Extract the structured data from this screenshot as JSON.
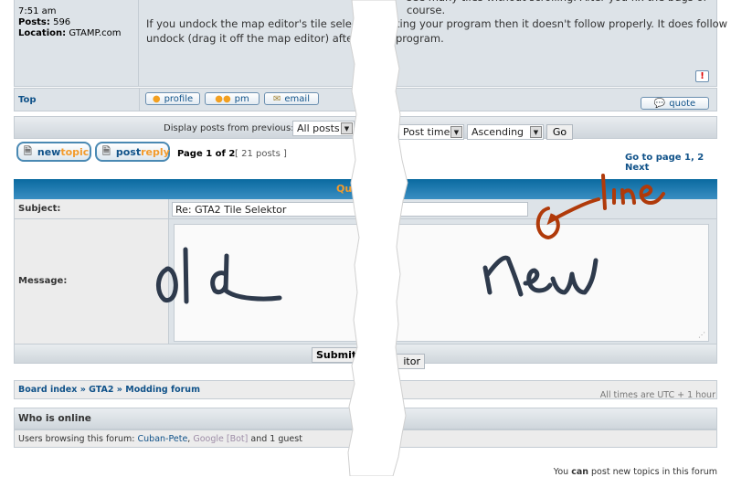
{
  "post": {
    "profile": {
      "joined_time": "7:51 am",
      "posts_label": "Posts:",
      "posts": "596",
      "location_label": "Location:",
      "location": "GTAMP.com"
    },
    "message_line0": "see many tiles without scrolling. After you fix the bugs of course.",
    "message_left_line1": "If you undock the map editor's tile selector be",
    "message_left_line2": "undock (drag it off the map editor) after run",
    "message_right_line1": "ting your program then it doesn't follow properly. It does follow if I",
    "message_right_line2": "program.",
    "top_link": "Top",
    "buttons": {
      "profile": "profile",
      "pm": "pm",
      "email": "email",
      "quote": "quote"
    }
  },
  "display_bar": {
    "label": "Display posts from previous:",
    "range": "All posts",
    "sort_by": "Post time",
    "order": "Ascending",
    "go": "Go"
  },
  "buttons": {
    "new_a": "new",
    "new_b": "topic",
    "post_a": "post",
    "post_b": "reply"
  },
  "pagination": {
    "page": "Page 1 of 2",
    "count": "[ 21 posts ]",
    "goto": "Go to page",
    "p1": "1,",
    "p2": "2",
    "next": "Next"
  },
  "quick_reply": {
    "title": "Qui",
    "subject_label": "Subject:",
    "subject_value": "Re: GTA2 Tile Selektor",
    "message_label": "Message:",
    "submit": "Submit",
    "full_editor": "itor"
  },
  "annotations": {
    "old": "old",
    "new": "new",
    "line": "line",
    "ink_color": "#2e3a4c",
    "marker_color": "#b03a0a"
  },
  "breadcrumb": {
    "board": "Board index",
    "sep1": "»",
    "gta2": "GTA2",
    "sep2": "»",
    "forum": "Modding forum",
    "timezone": "All times are UTC + 1 hour"
  },
  "online": {
    "title": "Who is online",
    "prefix": "Users browsing this forum:",
    "user1": "Cuban-Pete",
    "comma": ",",
    "user2": "Google [Bot]",
    "suffix": "and 1 guest"
  },
  "permissions": {
    "a": "You",
    "b": "can",
    "c": "post new topics in this forum"
  },
  "colors": {
    "link": "#105289",
    "header_blue": "#0a6aa0",
    "accent_orange": "#f39b2c",
    "bot": "#9e8da7"
  }
}
